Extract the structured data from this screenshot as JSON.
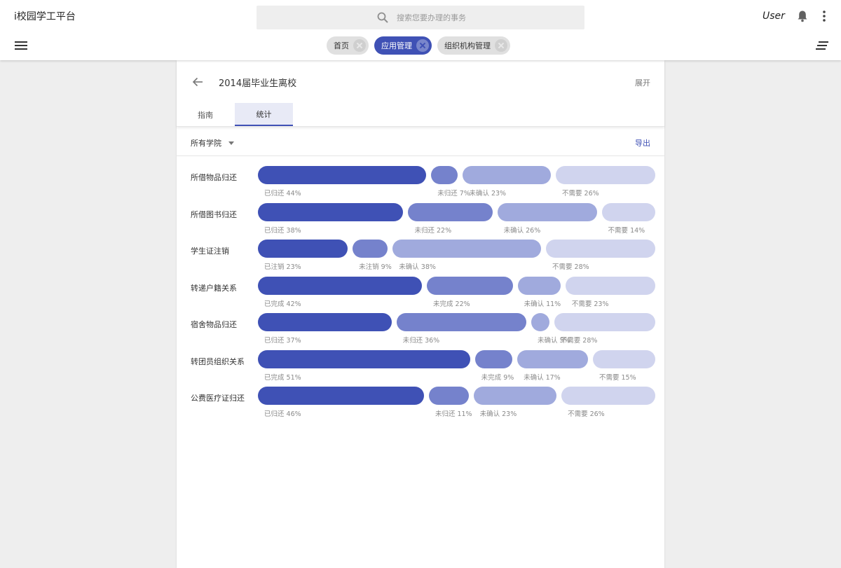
{
  "app": {
    "title": "i校园学工平台",
    "search_placeholder": "搜索您要办理的事务",
    "user": "User"
  },
  "chips": [
    {
      "label": "首页",
      "active": false
    },
    {
      "label": "应用管理",
      "active": true
    },
    {
      "label": "组织机构管理",
      "active": false
    }
  ],
  "page": {
    "title": "2014届毕业生离校",
    "expand": "展开",
    "tabs": [
      "指南",
      "统计"
    ],
    "active_tab": 1,
    "filter": "所有学院",
    "export": "导出"
  },
  "colors": {
    "accent": "#3f51b5",
    "segments": [
      "#3f51b5",
      "#7582cc",
      "#a0aadd",
      "#d0d4ee"
    ]
  },
  "stats": [
    {
      "item": "所借物品归还",
      "segments": [
        {
          "label": "已归还",
          "percent": 44
        },
        {
          "label": "未归还",
          "percent": 7
        },
        {
          "label": "未确认",
          "percent": 23
        },
        {
          "label": "不需要",
          "percent": 26
        }
      ]
    },
    {
      "item": "所借图书归还",
      "segments": [
        {
          "label": "已归还",
          "percent": 38
        },
        {
          "label": "未归还",
          "percent": 22
        },
        {
          "label": "未确认",
          "percent": 26
        },
        {
          "label": "不需要",
          "percent": 14
        }
      ]
    },
    {
      "item": "学生证注销",
      "segments": [
        {
          "label": "已注销",
          "percent": 23
        },
        {
          "label": "未注销",
          "percent": 9
        },
        {
          "label": "未确认",
          "percent": 38
        },
        {
          "label": "不需要",
          "percent": 28
        }
      ]
    },
    {
      "item": "转递户籍关系",
      "segments": [
        {
          "label": "已完成",
          "percent": 42
        },
        {
          "label": "未完成",
          "percent": 22
        },
        {
          "label": "未确认",
          "percent": 11
        },
        {
          "label": "不需要",
          "percent": 23
        }
      ]
    },
    {
      "item": "宿舍物品归还",
      "segments": [
        {
          "label": "已归还",
          "percent": 37
        },
        {
          "label": "未归还",
          "percent": 36
        },
        {
          "label": "未确认",
          "percent": 5
        },
        {
          "label": "不需要",
          "percent": 28
        }
      ]
    },
    {
      "item": "转团员组织关系",
      "segments": [
        {
          "label": "已完成",
          "percent": 51
        },
        {
          "label": "未完成",
          "percent": 9
        },
        {
          "label": "未确认",
          "percent": 17
        },
        {
          "label": "不需要",
          "percent": 15
        }
      ]
    },
    {
      "item": "公费医疗证归还",
      "segments": [
        {
          "label": "已归还",
          "percent": 46
        },
        {
          "label": "未归还",
          "percent": 11
        },
        {
          "label": "未确认",
          "percent": 23
        },
        {
          "label": "不需要",
          "percent": 26
        }
      ]
    }
  ]
}
